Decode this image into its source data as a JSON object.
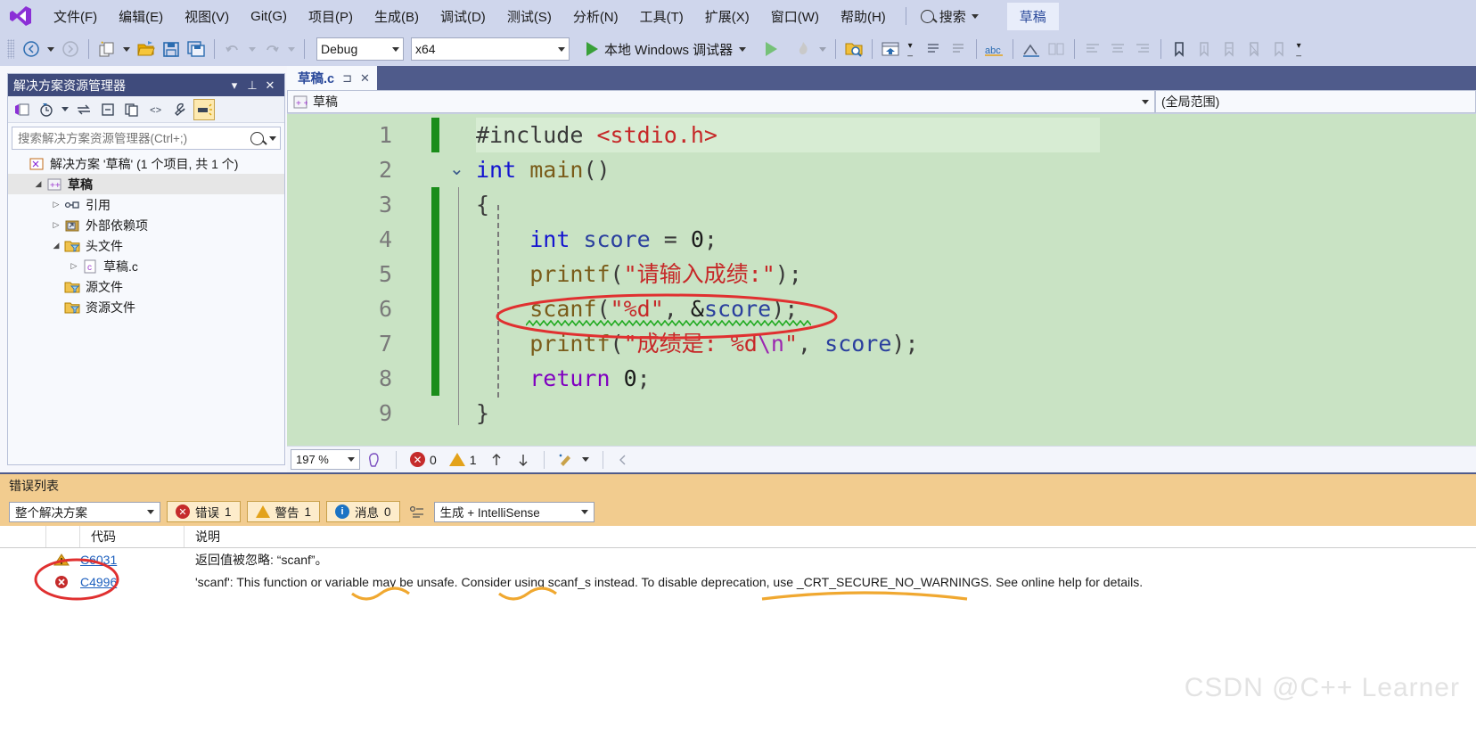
{
  "menubar": {
    "logo_icon": "visual-studio-logo",
    "items": [
      "文件(F)",
      "编辑(E)",
      "视图(V)",
      "Git(G)",
      "项目(P)",
      "生成(B)",
      "调试(D)",
      "测试(S)",
      "分析(N)",
      "工具(T)",
      "扩展(X)",
      "窗口(W)",
      "帮助(H)"
    ],
    "search_label": "搜索",
    "project_chip": "草稿"
  },
  "toolbar": {
    "back_icon": "back-arrow-icon",
    "forward_icon": "forward-arrow-icon",
    "new_item_icon": "new-item-icon",
    "open_icon": "open-folder-icon",
    "save_icon": "save-icon",
    "save_all_icon": "save-all-icon",
    "undo_icon": "undo-icon",
    "redo_icon": "redo-icon",
    "config": "Debug",
    "platform": "x64",
    "run_label": "本地 Windows 调试器",
    "run_icon": "play-icon",
    "start_without_debug_icon": "play-hollow-icon",
    "hotreload_icon": "hot-reload-icon",
    "folder_search_icon": "folder-search-icon",
    "home_window_icon": "home-window-icon",
    "abc_icon": "abc-icon",
    "bookmark_icon": "bookmark-icon"
  },
  "solution_explorer": {
    "title": "解决方案资源管理器",
    "title_icons": [
      "chevron-down-icon",
      "pin-icon",
      "close-icon"
    ],
    "search_placeholder": "搜索解决方案资源管理器(Ctrl+;)",
    "toolbar_icons": [
      "home-view-icon",
      "pending-changes-icon",
      "sync-icon",
      "collapse-all-icon",
      "copy-icon",
      "show-all-files-icon",
      "properties-icon",
      "preview-selected-icon"
    ],
    "tree": [
      {
        "label": "解决方案 '草稿' (1 个项目, 共 1 个)",
        "indent": 0,
        "arrow": "",
        "icon": "solution-icon",
        "selected": false
      },
      {
        "label": "草稿",
        "indent": 1,
        "arrow": "open",
        "icon": "cpp-project-icon",
        "selected": true,
        "bold": true
      },
      {
        "label": "引用",
        "indent": 2,
        "arrow": "closed",
        "icon": "references-icon",
        "selected": false
      },
      {
        "label": "外部依赖项",
        "indent": 2,
        "arrow": "closed",
        "icon": "ext-deps-icon",
        "selected": false
      },
      {
        "label": "头文件",
        "indent": 2,
        "arrow": "open",
        "icon": "filter-folder-icon",
        "selected": false
      },
      {
        "label": "草稿.c",
        "indent": 3,
        "arrow": "closed",
        "icon": "c-file-icon",
        "selected": false
      },
      {
        "label": "源文件",
        "indent": 2,
        "arrow": "",
        "icon": "filter-folder-icon",
        "selected": false
      },
      {
        "label": "资源文件",
        "indent": 2,
        "arrow": "",
        "icon": "filter-folder-icon",
        "selected": false
      }
    ]
  },
  "editor": {
    "tab_label": "草稿.c",
    "tab_pin_icon": "pin-icon",
    "tab_close_icon": "close-icon",
    "nav_left": "草稿",
    "nav_left_icon": "cpp-project-icon",
    "nav_right": "(全局范围)",
    "code": [
      {
        "n": "1",
        "changed": true,
        "fold": "",
        "highlight": true,
        "tokens": [
          {
            "t": "#include ",
            "c": "pp"
          },
          {
            "t": "<stdio.h>",
            "c": "str"
          }
        ]
      },
      {
        "n": "2",
        "changed": false,
        "fold": "down",
        "highlight": false,
        "tokens": [
          {
            "t": "int",
            "c": "kw"
          },
          {
            "t": " ",
            "c": "pp"
          },
          {
            "t": "main",
            "c": "fn"
          },
          {
            "t": "()",
            "c": "pp"
          }
        ]
      },
      {
        "n": "3",
        "changed": true,
        "fold": "",
        "highlight": false,
        "tokens": [
          {
            "t": "{",
            "c": "pp"
          }
        ]
      },
      {
        "n": "4",
        "changed": true,
        "fold": "",
        "highlight": false,
        "tokens": [
          {
            "t": "    ",
            "c": "pp"
          },
          {
            "t": "int",
            "c": "kw"
          },
          {
            "t": " ",
            "c": "pp"
          },
          {
            "t": "score",
            "c": "var"
          },
          {
            "t": " = ",
            "c": "pp"
          },
          {
            "t": "0",
            "c": "num"
          },
          {
            "t": ";",
            "c": "pp"
          }
        ]
      },
      {
        "n": "5",
        "changed": true,
        "fold": "",
        "highlight": false,
        "tokens": [
          {
            "t": "    ",
            "c": "pp"
          },
          {
            "t": "printf",
            "c": "fn"
          },
          {
            "t": "(",
            "c": "pp"
          },
          {
            "t": "\"请输入成绩:\"",
            "c": "str"
          },
          {
            "t": ");",
            "c": "pp"
          }
        ]
      },
      {
        "n": "6",
        "changed": true,
        "fold": "",
        "highlight": false,
        "squiggle": true,
        "tokens": [
          {
            "t": "    ",
            "c": "pp"
          },
          {
            "t": "scanf",
            "c": "fn"
          },
          {
            "t": "(",
            "c": "pp"
          },
          {
            "t": "\"%d\"",
            "c": "str"
          },
          {
            "t": ", ",
            "c": "pp"
          },
          {
            "t": "&",
            "c": "num"
          },
          {
            "t": "score",
            "c": "var"
          },
          {
            "t": ");",
            "c": "pp"
          }
        ]
      },
      {
        "n": "7",
        "changed": true,
        "fold": "",
        "highlight": false,
        "tokens": [
          {
            "t": "    ",
            "c": "pp"
          },
          {
            "t": "printf",
            "c": "fn"
          },
          {
            "t": "(",
            "c": "pp"
          },
          {
            "t": "\"成绩是: %d",
            "c": "str"
          },
          {
            "t": "\\n",
            "c": "esc"
          },
          {
            "t": "\"",
            "c": "str"
          },
          {
            "t": ", ",
            "c": "pp"
          },
          {
            "t": "score",
            "c": "var"
          },
          {
            "t": ");",
            "c": "pp"
          }
        ]
      },
      {
        "n": "8",
        "changed": true,
        "fold": "",
        "highlight": false,
        "tokens": [
          {
            "t": "    ",
            "c": "pp"
          },
          {
            "t": "return",
            "c": "kw2"
          },
          {
            "t": " ",
            "c": "pp"
          },
          {
            "t": "0",
            "c": "num"
          },
          {
            "t": ";",
            "c": "pp"
          }
        ]
      },
      {
        "n": "9",
        "changed": false,
        "fold": "",
        "highlight": false,
        "tokens": [
          {
            "t": "}",
            "c": "pp"
          }
        ]
      }
    ],
    "status": {
      "zoom": "197 %",
      "zoom_caret_icon": "chevron-down-icon",
      "intellisense_icon": "intellisense-icon",
      "error_count": "0",
      "warning_count": "1",
      "prev_icon": "arrow-up-icon",
      "next_icon": "arrow-down-icon",
      "quickfix_icon": "quick-actions-icon",
      "scroll_left_icon": "scroll-left-icon"
    }
  },
  "error_list": {
    "title": "错误列表",
    "scope": "整个解决方案",
    "chips": [
      {
        "icon": "error-icon",
        "label": "错误",
        "count": "1"
      },
      {
        "icon": "warning-icon",
        "label": "警告",
        "count": "1"
      },
      {
        "icon": "info-icon",
        "label": "消息",
        "count": "0"
      }
    ],
    "filter_icon": "filter-list-icon",
    "build_filter": "生成 + IntelliSense",
    "columns": [
      "",
      "",
      "代码",
      "说明"
    ],
    "rows": [
      {
        "severity": "warning-icon",
        "code": "C6031",
        "desc": "返回值被忽略: “scanf”。"
      },
      {
        "severity": "error-icon",
        "code": "C4996",
        "desc": "'scanf': This function or variable may be unsafe. Consider using scanf_s instead. To disable deprecation, use _CRT_SECURE_NO_WARNINGS. See online help for details."
      }
    ]
  },
  "annotations": {
    "ellipse_code_color": "#e03030",
    "ellipse_error_color": "#e03030",
    "underline_color": "#f0a830",
    "squiggle_color": "#1faa1f"
  },
  "watermark": "CSDN @C++ Learner"
}
